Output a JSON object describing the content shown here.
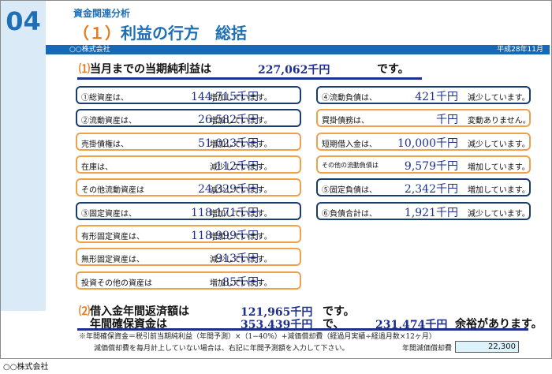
{
  "page_number": "04",
  "subtitle": "資金関連分析",
  "title": {
    "marker": "（１）",
    "text": "利益の行方　総括"
  },
  "company": "○○株式会社",
  "date": "平成28年11月",
  "net_income_line": {
    "marker": "⑴",
    "label": "当月までの当期純利益は",
    "amount": "227,062千円",
    "suffix": "です。"
  },
  "left_items": [
    {
      "label": "①総資産は、",
      "amount": "144,715千円",
      "status": "増加しています。",
      "style": "blue"
    },
    {
      "label": "②流動資産は、",
      "amount": "26,582千円",
      "status": "増加しています。",
      "style": "blue"
    },
    {
      "label": "売掛債権は、",
      "amount": "51,023千円",
      "status": "増加しています。",
      "style": "orange"
    },
    {
      "label": "在庫は、",
      "amount": "112千円",
      "status": "減少しています。",
      "style": "orange"
    },
    {
      "label": "その他流動資産は",
      "amount": "24,329千円",
      "status": "減少しています。",
      "style": "orange"
    },
    {
      "label": "③固定資産は、",
      "amount": "118,171千円",
      "status": "増加しています。",
      "style": "blue"
    },
    {
      "label": "有形固定資産は、",
      "amount": "118,999千円",
      "status": "増加しています。",
      "style": "orange"
    },
    {
      "label": "無形固定資産は、",
      "amount": "913千円",
      "status": "減少しています。",
      "style": "orange"
    },
    {
      "label": "投資その他の資産は",
      "amount": "85千円",
      "status": "増加しています。",
      "style": "orange"
    }
  ],
  "right_items": [
    {
      "label": "④流動負債は、",
      "amount": "421千円",
      "status": "減少しています。",
      "style": "blue"
    },
    {
      "label": "買掛債務は、",
      "amount": "千円",
      "status": "変動ありません。",
      "style": "orange"
    },
    {
      "label": "短期借入金は、",
      "amount": "10,000千円",
      "status": "減少しています。",
      "style": "orange"
    },
    {
      "label": "その他の流動負債は",
      "amount": "9,579千円",
      "status": "増加しています。",
      "style": "orange"
    },
    {
      "label": "⑤固定負債は、",
      "amount": "2,342千円",
      "status": "増加しています。",
      "style": "blue"
    },
    {
      "label": "⑥負債合計は、",
      "amount": "1,921千円",
      "status": "減少しています。",
      "style": "blue"
    }
  ],
  "repayment_line": {
    "marker": "⑵",
    "label": "借入金年間返済額は",
    "amount": "121,965千円",
    "suffix": "です。"
  },
  "fund_line": {
    "label": "年間確保資金は",
    "amount": "353,439千円",
    "middle": "で、",
    "surplus": "231,474千円",
    "suffix": "余裕があります。"
  },
  "note1": "※年間確保資金＝税引前当期純利益（年間予測）×（1−40%）+減価償却費（経過月実績÷経過月数×12ヶ月）",
  "note2": "減価償却費を毎月計上していない場合は、右記に年間予測額を入力して下さい。",
  "depreciation": {
    "label": "年間減価償却費",
    "value": "22,300"
  },
  "footer_company": "○○株式会社"
}
